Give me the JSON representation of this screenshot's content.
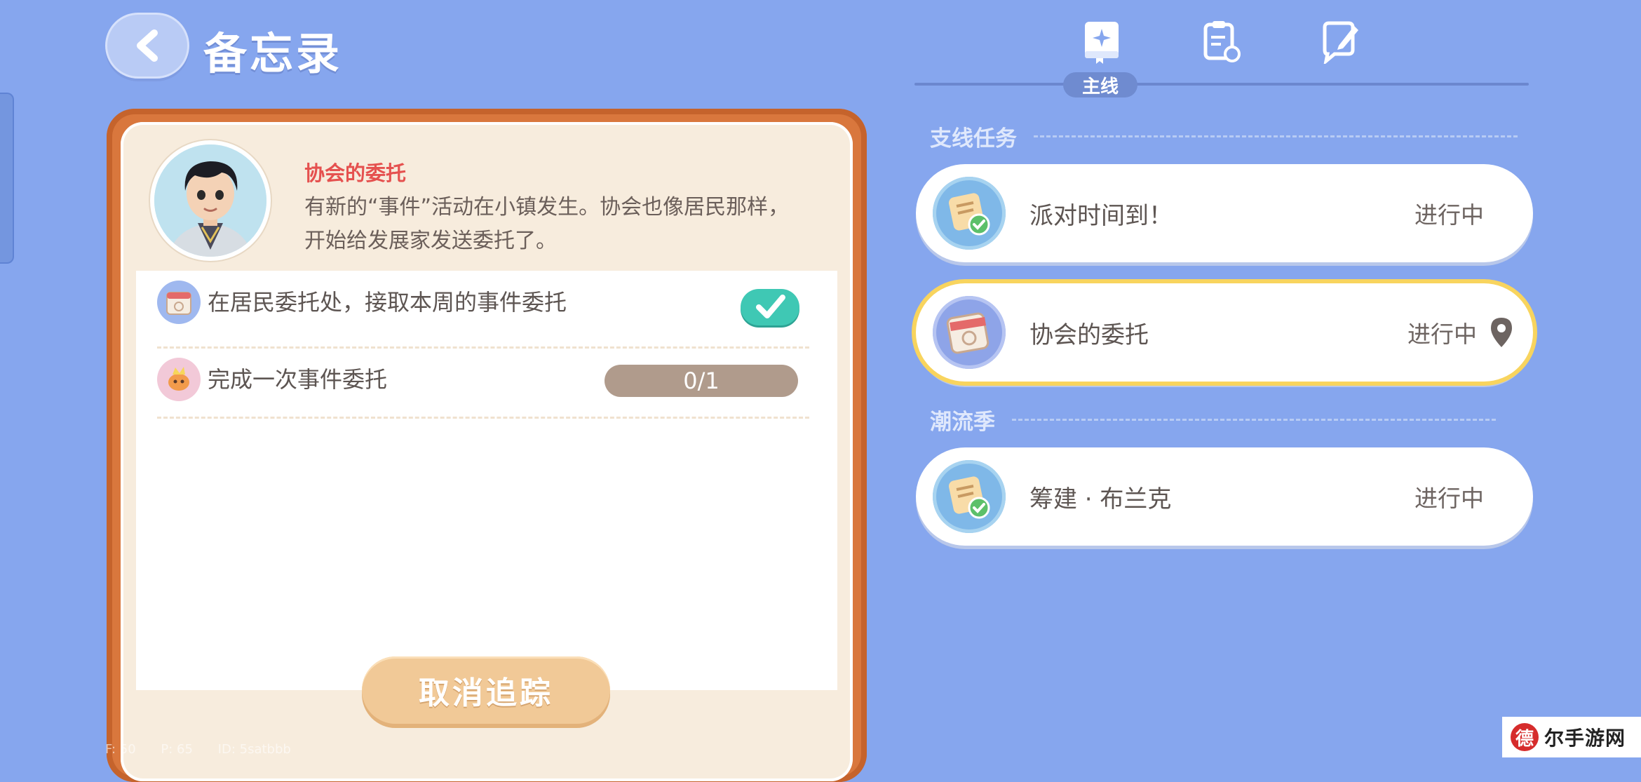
{
  "header": {
    "title": "备忘录"
  },
  "quest_detail": {
    "title": "协会的委托",
    "description": "有新的“事件”活动在小镇发生。协会也像居民那样，开始给发展家发送委托了。",
    "objectives": [
      {
        "text": "在居民委托处，接取本周的事件委托",
        "status": "completed"
      },
      {
        "text": "完成一次事件委托",
        "progress": "0/1"
      }
    ],
    "cancel_label": "取消追踪"
  },
  "debug": {
    "f": "F: 50",
    "p": "P: 65",
    "id": "ID: 5satbbb"
  },
  "tabs": {
    "active_label": "主线",
    "icons": [
      "star-book-icon",
      "clipboard-refresh-icon",
      "pen-note-icon"
    ]
  },
  "sections": [
    {
      "title": "支线任务",
      "quests": [
        {
          "name": "派对时间到！",
          "status": "进行中",
          "tracked": false
        },
        {
          "name": "协会的委托",
          "status": "进行中",
          "tracked": true
        }
      ]
    },
    {
      "title": "潮流季",
      "quests": [
        {
          "name": "筹建 · 布兰克",
          "status": "进行中",
          "tracked": false
        }
      ]
    }
  ],
  "watermark": {
    "logo_char": "德",
    "text": "尔手游网"
  },
  "colors": {
    "background": "#86a6ee",
    "card_frame": "#d9773d",
    "quest_title": "#e5514f",
    "check": "#3fc8b4",
    "highlight": "#f8d45e"
  }
}
